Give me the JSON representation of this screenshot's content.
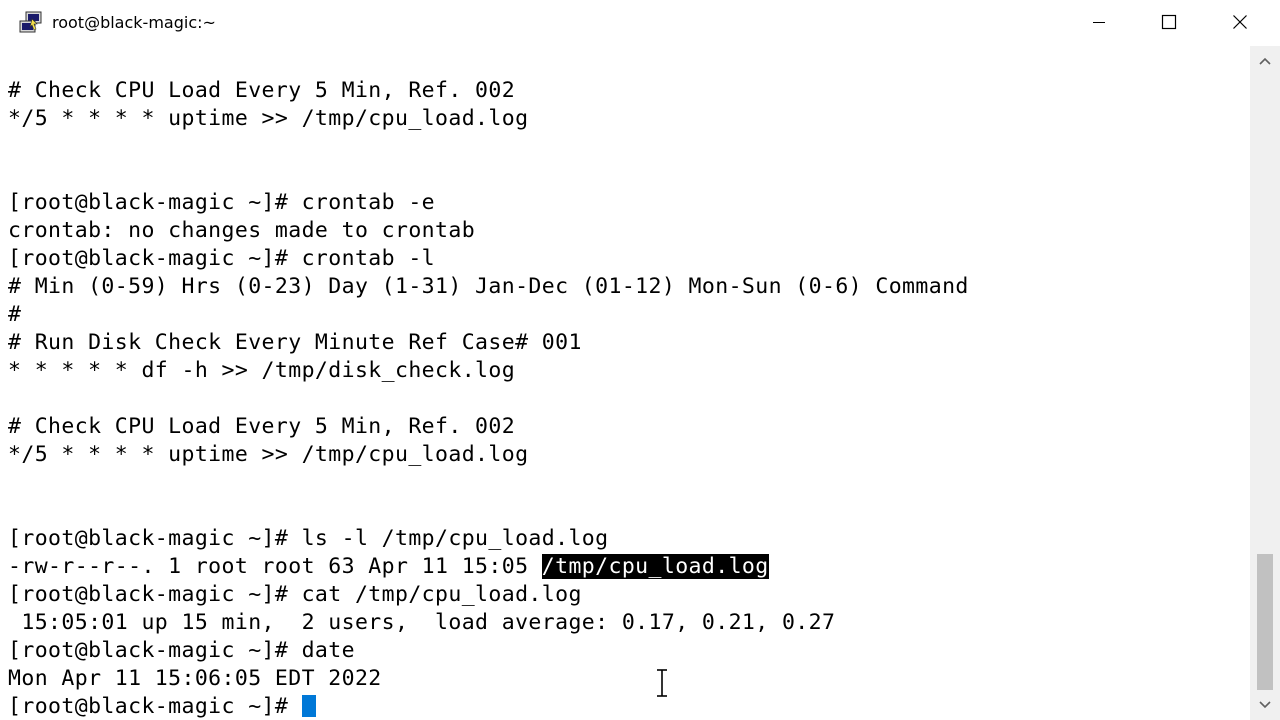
{
  "window": {
    "title": "root@black-magic:~"
  },
  "terminal": {
    "lines": [
      "# Check CPU Load Every 5 Min, Ref. 002",
      "*/5 * * * * uptime >> /tmp/cpu_load.log",
      "",
      "",
      "[root@black-magic ~]# crontab -e",
      "crontab: no changes made to crontab",
      "[root@black-magic ~]# crontab -l",
      "# Min (0-59) Hrs (0-23) Day (1-31) Jan-Dec (01-12) Mon-Sun (0-6) Command",
      "#",
      "# Run Disk Check Every Minute Ref Case# 001",
      "* * * * * df -h >> /tmp/disk_check.log",
      "",
      "# Check CPU Load Every 5 Min, Ref. 002",
      "*/5 * * * * uptime >> /tmp/cpu_load.log",
      "",
      "",
      "[root@black-magic ~]# ls -l /tmp/cpu_load.log",
      "",
      "[root@black-magic ~]# cat /tmp/cpu_load.log",
      " 15:05:01 up 15 min,  2 users,  load average: 0.17, 0.21, 0.27",
      "[root@black-magic ~]# date",
      "Mon Apr 11 15:06:05 EDT 2022",
      ""
    ],
    "ls_output_prefix": "-rw-r--r--. 1 root root 63 Apr 11 15:05 ",
    "ls_output_selected": "/tmp/cpu_load.log",
    "prompt": "[root@black-magic ~]# "
  },
  "colors": {
    "background": "#ffffff",
    "foreground": "#000000",
    "selection_bg": "#000000",
    "selection_fg": "#ffffff",
    "cursor": "#0078d7"
  },
  "icons": {
    "app": "putty-icon",
    "minimize": "minimize-icon",
    "maximize": "maximize-icon",
    "close": "close-icon"
  }
}
